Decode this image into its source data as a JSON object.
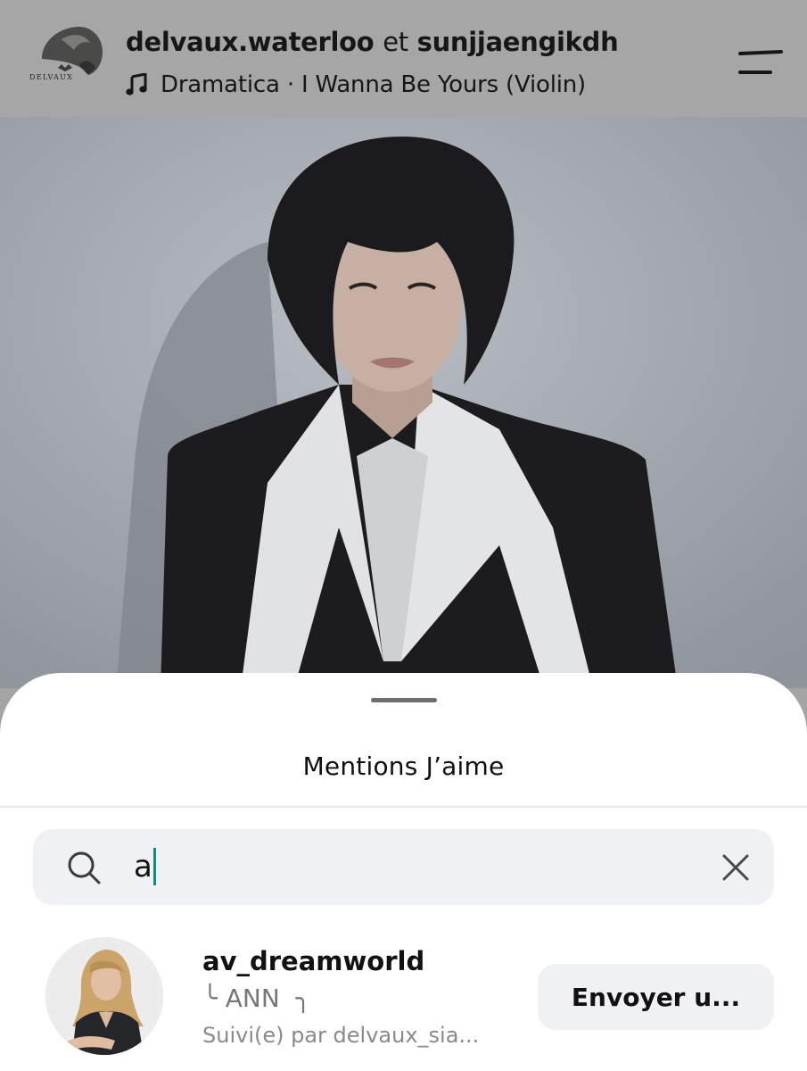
{
  "post_header": {
    "owner_logo_text": "DELVAUX",
    "owner_name": "delvaux.waterloo",
    "joiner": "et",
    "collaborator_name": "sunjjaengikdh",
    "music_icon": "music-note-icon",
    "music_text": "Dramatica · I Wanna Be Yours (Violin)",
    "menu_icon": "hamburger-menu-icon"
  },
  "likes_sheet": {
    "title": "Mentions J’aime",
    "search": {
      "icon": "search-icon",
      "value": "a",
      "clear_icon": "close-icon"
    },
    "results": [
      {
        "username": "av_dreamworld",
        "display_name": "╰ ANN  ╮",
        "followed_by": "Suivi(e) par delvaux_sia...",
        "button_label": "Envoyer u..."
      }
    ]
  },
  "colors": {
    "overlay_gray": "#a6a6a6",
    "sheet_background": "#ffffff",
    "input_background": "#eff1f4",
    "caret": "#0e8f7e",
    "handle": "#6e6e6e"
  }
}
